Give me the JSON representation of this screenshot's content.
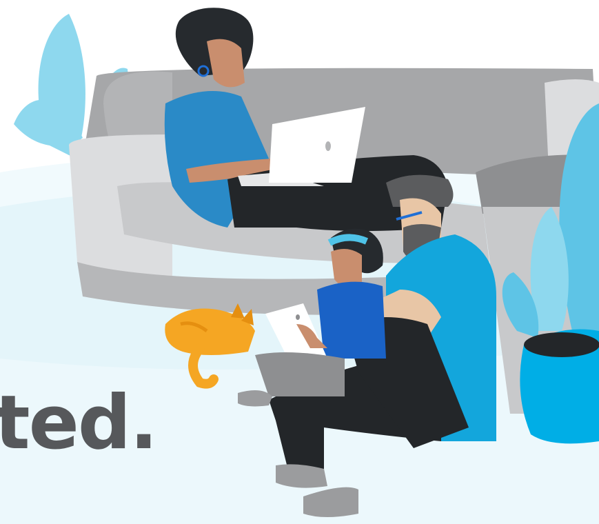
{
  "headline": {
    "text": "ted."
  },
  "colors": {
    "background": "#ffffff",
    "floor": "#e4f5fa",
    "floor_light": "#f1fafd",
    "couch": "#c8c9cb",
    "couch_dark": "#a6a7a9",
    "couch_light": "#dcdddf",
    "pillow": "#8e8f91",
    "plant_light": "#8ed8ee",
    "plant": "#5ec4e6",
    "pot": "#00aee6",
    "skin": "#c98e6e",
    "hair": "#262a2e",
    "shirt_woman": "#2a8ac7",
    "pants": "#232629",
    "laptop": "#ffffff",
    "shirt_man": "#13a6dc",
    "shirt_girl": "#1a62c6",
    "headband": "#4fc3e8",
    "glasses": "#1f6fd6",
    "socks": "#9b9c9e",
    "cat": "#f5a623",
    "cat_dark": "#e58f10",
    "text": "#56585b"
  },
  "icons": [
    "woman-with-laptop",
    "man-with-beard",
    "girl-with-tablet",
    "cat",
    "potted-plant",
    "couch"
  ]
}
